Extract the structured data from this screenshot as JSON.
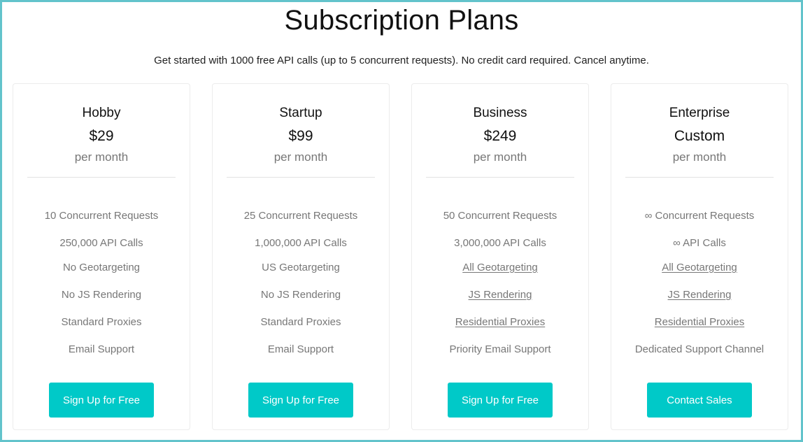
{
  "header": {
    "title": "Subscription Plans",
    "subtitle": "Get started with 1000 free API calls (up to 5 concurrent requests). No credit card required. Cancel anytime."
  },
  "colors": {
    "accent": "#00c9c8",
    "frame_border": "#62c3cb",
    "muted_text": "#777777"
  },
  "plans": [
    {
      "name": "Hobby",
      "price": "$29",
      "period": "per month",
      "features": [
        {
          "text": "10 Concurrent Requests",
          "link": false
        },
        {
          "text": "250,000 API Calls",
          "link": false
        },
        {
          "text": "No Geotargeting",
          "link": false
        },
        {
          "text": "No JS Rendering",
          "link": false
        },
        {
          "text": "Standard Proxies",
          "link": false
        },
        {
          "text": "Email Support",
          "link": false
        }
      ],
      "cta": "Sign Up for Free"
    },
    {
      "name": "Startup",
      "price": "$99",
      "period": "per month",
      "features": [
        {
          "text": "25 Concurrent Requests",
          "link": false
        },
        {
          "text": "1,000,000 API Calls",
          "link": false
        },
        {
          "text": "US Geotargeting",
          "link": false
        },
        {
          "text": "No JS Rendering",
          "link": false
        },
        {
          "text": "Standard Proxies",
          "link": false
        },
        {
          "text": "Email Support",
          "link": false
        }
      ],
      "cta": "Sign Up for Free"
    },
    {
      "name": "Business",
      "price": "$249",
      "period": "per month",
      "features": [
        {
          "text": "50 Concurrent Requests",
          "link": false
        },
        {
          "text": "3,000,000 API Calls",
          "link": false
        },
        {
          "text": "All Geotargeting",
          "link": true
        },
        {
          "text": "JS Rendering",
          "link": true
        },
        {
          "text": "Residential Proxies",
          "link": true
        },
        {
          "text": "Priority Email Support",
          "link": false
        }
      ],
      "cta": "Sign Up for Free"
    },
    {
      "name": "Enterprise",
      "price": "Custom",
      "period": "per month",
      "features": [
        {
          "text": "∞ Concurrent Requests",
          "link": false
        },
        {
          "text": "∞ API Calls",
          "link": false
        },
        {
          "text": "All Geotargeting",
          "link": true
        },
        {
          "text": "JS Rendering",
          "link": true
        },
        {
          "text": "Residential Proxies",
          "link": true
        },
        {
          "text": "Dedicated Support Channel",
          "link": false
        }
      ],
      "cta": "Contact Sales"
    }
  ]
}
